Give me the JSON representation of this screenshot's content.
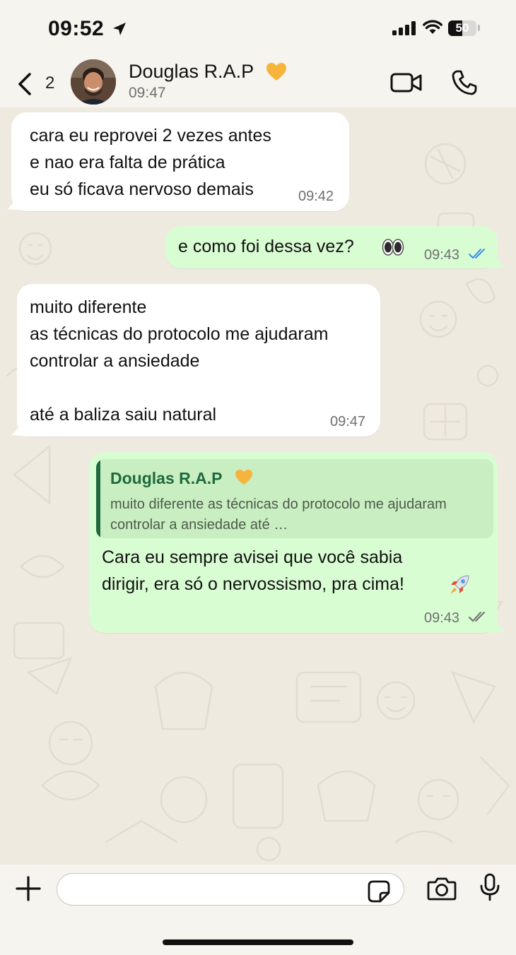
{
  "status_bar": {
    "time": "09:52",
    "battery": "50",
    "battery_level": 0.5
  },
  "header": {
    "back_count": "2",
    "contact_name": "Douglas R.A.P",
    "contact_emoji": "yellow-heart",
    "last_seen": "09:47"
  },
  "messages": [
    {
      "direction": "incoming",
      "text": "cara eu reprovei 2 vezes antes\ne nao era falta de prática\neu só ficava nervoso demais",
      "time": "09:42"
    },
    {
      "direction": "outgoing",
      "text": "e como foi dessa vez?",
      "emoji": "eyes",
      "time": "09:43",
      "status": "read"
    },
    {
      "direction": "incoming",
      "text": "muito diferente\nas técnicas do protocolo me ajudaram\ncontrolar a ansiedade\n\naté a baliza saiu natural",
      "time": "09:47"
    },
    {
      "direction": "outgoing",
      "quote": {
        "author": "Douglas R.A.P",
        "text": "muito diferente as técnicas do protocolo me ajudaram controlar a ansiedade até …"
      },
      "text": "Cara eu sempre avisei que você sabia\ndirigir, era só o nervossismo, pra cima!",
      "emoji": "rocket",
      "time": "09:43",
      "status": "delivered"
    }
  ],
  "input": {
    "value": "",
    "placeholder": ""
  },
  "colors": {
    "outgoing_bubble": "#d9fdd3",
    "incoming_bubble": "#ffffff",
    "chat_background": "#efeae0",
    "read_tick": "#3b8ee6",
    "quote_accent": "#1f6a3e"
  }
}
